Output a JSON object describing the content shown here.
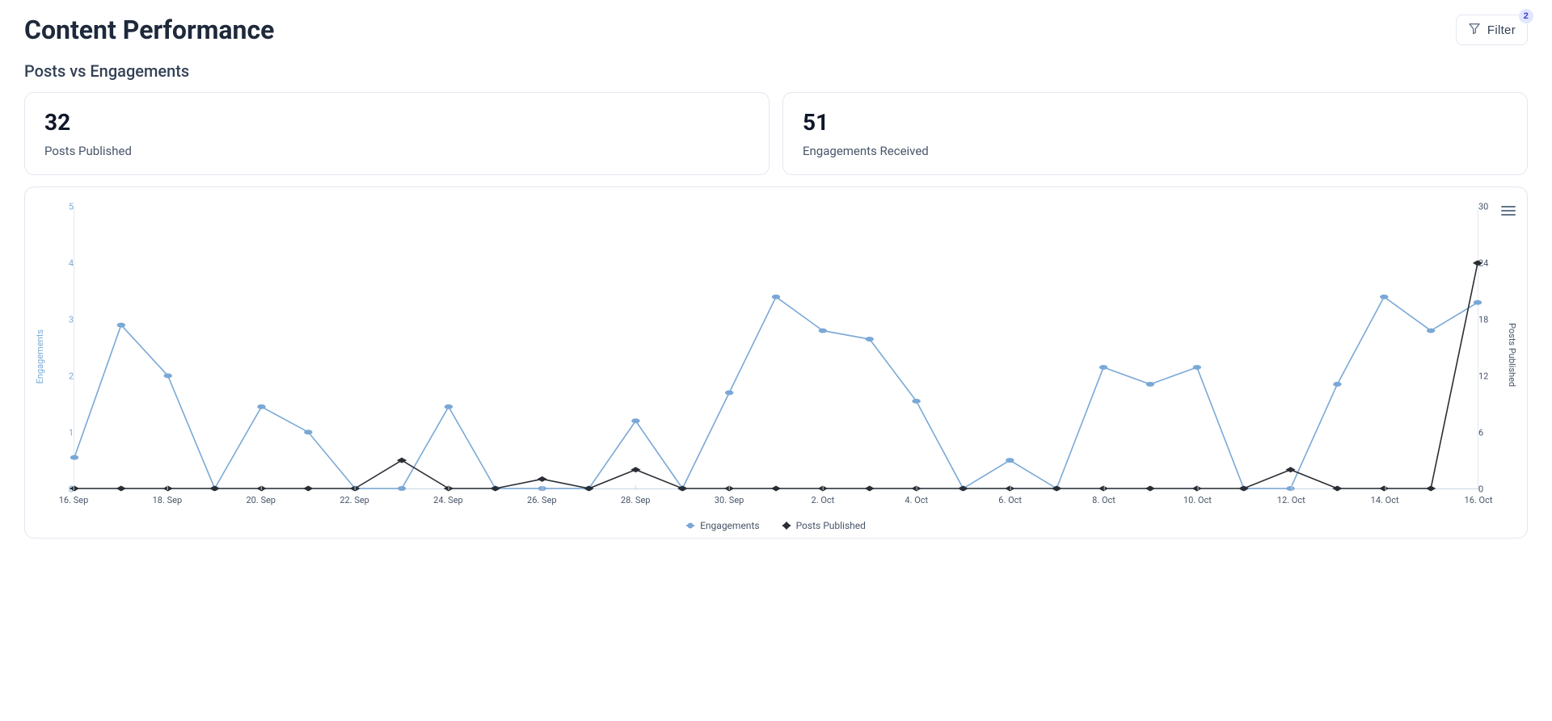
{
  "header": {
    "title": "Content Performance",
    "filter_label": "Filter",
    "filter_count": "2"
  },
  "subheading": "Posts vs Engagements",
  "stats": {
    "posts_published": {
      "value": "32",
      "label": "Posts Published"
    },
    "engagements_received": {
      "value": "51",
      "label": "Engagements Received"
    }
  },
  "legend": {
    "engagements": "Engagements",
    "posts_published": "Posts Published"
  },
  "axes": {
    "left_title": "Engagements",
    "right_title": "Posts Published",
    "left_ticks": [
      "0",
      "1",
      "2",
      "3",
      "4",
      "5"
    ],
    "right_ticks": [
      "0",
      "6",
      "12",
      "18",
      "24",
      "30"
    ],
    "x_tick_labels": [
      "16. Sep",
      "18. Sep",
      "20. Sep",
      "22. Sep",
      "24. Sep",
      "26. Sep",
      "28. Sep",
      "30. Sep",
      "2. Oct",
      "4. Oct",
      "6. Oct",
      "8. Oct",
      "10. Oct",
      "12. Oct",
      "14. Oct",
      "16. Oct"
    ]
  },
  "chart_data": {
    "type": "line",
    "x": [
      "16 Sep",
      "17 Sep",
      "18 Sep",
      "19 Sep",
      "20 Sep",
      "21 Sep",
      "22 Sep",
      "23 Sep",
      "24 Sep",
      "25 Sep",
      "26 Sep",
      "27 Sep",
      "28 Sep",
      "29 Sep",
      "30 Sep",
      "1 Oct",
      "2 Oct",
      "3 Oct",
      "4 Oct",
      "5 Oct",
      "6 Oct",
      "7 Oct",
      "8 Oct",
      "9 Oct",
      "10 Oct",
      "11 Oct",
      "12 Oct",
      "13 Oct",
      "14 Oct",
      "15 Oct",
      "16 Oct"
    ],
    "series": [
      {
        "name": "Engagements",
        "axis": "left",
        "values": [
          0.55,
          2.9,
          2.0,
          0,
          1.45,
          1.0,
          0,
          0,
          1.45,
          0,
          0,
          0,
          1.2,
          0,
          1.7,
          3.4,
          2.8,
          2.65,
          1.55,
          0,
          0.5,
          0,
          2.15,
          1.85,
          2.15,
          0,
          0,
          1.85,
          3.4,
          2.8,
          3.3
        ]
      },
      {
        "name": "Posts Published",
        "axis": "right",
        "values": [
          0,
          0,
          0,
          0,
          0,
          0,
          0,
          3,
          0,
          0,
          1,
          0,
          2,
          0,
          0,
          0,
          0,
          0,
          0,
          0,
          0,
          0,
          0,
          0,
          0,
          0,
          2,
          0,
          0,
          0,
          24
        ]
      }
    ],
    "y_left": {
      "min": 0,
      "max": 5,
      "label": "Engagements"
    },
    "y_right": {
      "min": 0,
      "max": 30,
      "label": "Posts Published"
    },
    "xlabel": "",
    "title": ""
  }
}
